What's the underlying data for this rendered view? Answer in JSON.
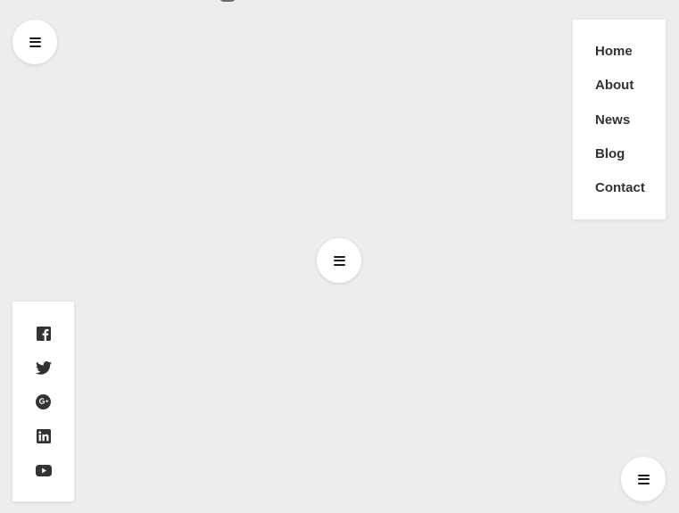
{
  "colors": {
    "background": "#ededed",
    "panel": "#ffffff",
    "icon": "#333333",
    "text": "#333333"
  },
  "menu_buttons": {
    "top_left_icon": "hamburger-menu-icon",
    "center_icon": "hamburger-menu-icon",
    "bottom_right_icon": "hamburger-menu-icon"
  },
  "nav": {
    "items": [
      {
        "label": "Home"
      },
      {
        "label": "About"
      },
      {
        "label": "News"
      },
      {
        "label": "Blog"
      },
      {
        "label": "Contact"
      }
    ]
  },
  "social": {
    "items": [
      {
        "icon": "facebook-icon"
      },
      {
        "icon": "twitter-icon"
      },
      {
        "icon": "google-plus-icon"
      },
      {
        "icon": "linkedin-icon"
      },
      {
        "icon": "youtube-icon"
      }
    ]
  }
}
